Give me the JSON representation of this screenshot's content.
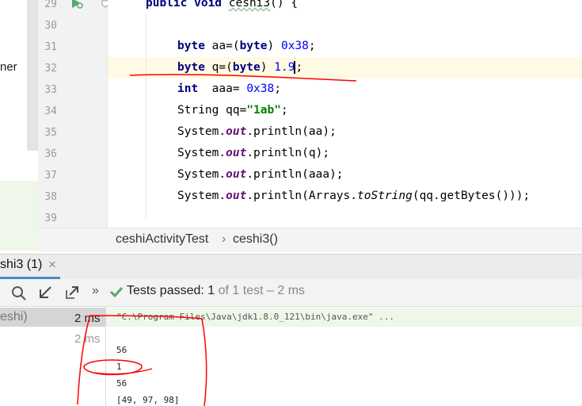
{
  "left_partial_text": "ner",
  "editor": {
    "line_numbers": [
      "29",
      "30",
      "31",
      "32",
      "33",
      "34",
      "35",
      "36",
      "37",
      "38",
      "39"
    ],
    "lines": {
      "l29_kw": "public void ",
      "l29_name": "ceshi3",
      "l29_rest": "() {",
      "l31_kw1": "byte",
      "l31_mid": " aa=(",
      "l31_kw2": "byte",
      "l31_end": ") ",
      "l31_num": "0x38",
      "l31_semi": ";",
      "l32_kw1": "byte",
      "l32_mid": " q=(",
      "l32_kw2": "byte",
      "l32_end": ") ",
      "l32_num": "1.9",
      "l32_semi": ";",
      "l33_kw": "int",
      "l33_mid": "  aaa= ",
      "l33_num": "0x38",
      "l33_semi": ";",
      "l34_a": "String qq=",
      "l34_str": "\"1ab\"",
      "l34_semi": ";",
      "sys": "System.",
      "out": "out",
      "println_aa": ".println(aa);",
      "println_q": ".println(q);",
      "println_aaa": ".println(aaa);",
      "l38_a": ".println(Arrays.",
      "l38_tostring": "toString",
      "l38_b": "(qq.getBytes()));"
    }
  },
  "breadcrumb": {
    "class_name": "ceshiActivityTest",
    "separator": "›",
    "method_name": "ceshi3()"
  },
  "run_tab": {
    "label": "shi3 (1)",
    "close": "×"
  },
  "toolbar": {
    "more": "»",
    "status_bold": "Tests passed: ",
    "count": "1",
    "status_rest": " of 1 test – 2 ms"
  },
  "tree": {
    "items": [
      {
        "name": "eshi)",
        "time": "2 ms"
      },
      {
        "name": "",
        "time": "2 ms"
      }
    ]
  },
  "console": {
    "lines": [
      "\"C:\\Program Files\\Java\\jdk1.8.0_121\\bin\\java.exe\" ...",
      "",
      "56",
      "1",
      "56",
      "[49, 97, 98]"
    ]
  },
  "colors": {
    "keyword": "#000080",
    "number": "#0000ff",
    "string": "#008000",
    "field": "#660e7a",
    "pass_green": "#59a869",
    "annotation_red": "#ff0000"
  }
}
